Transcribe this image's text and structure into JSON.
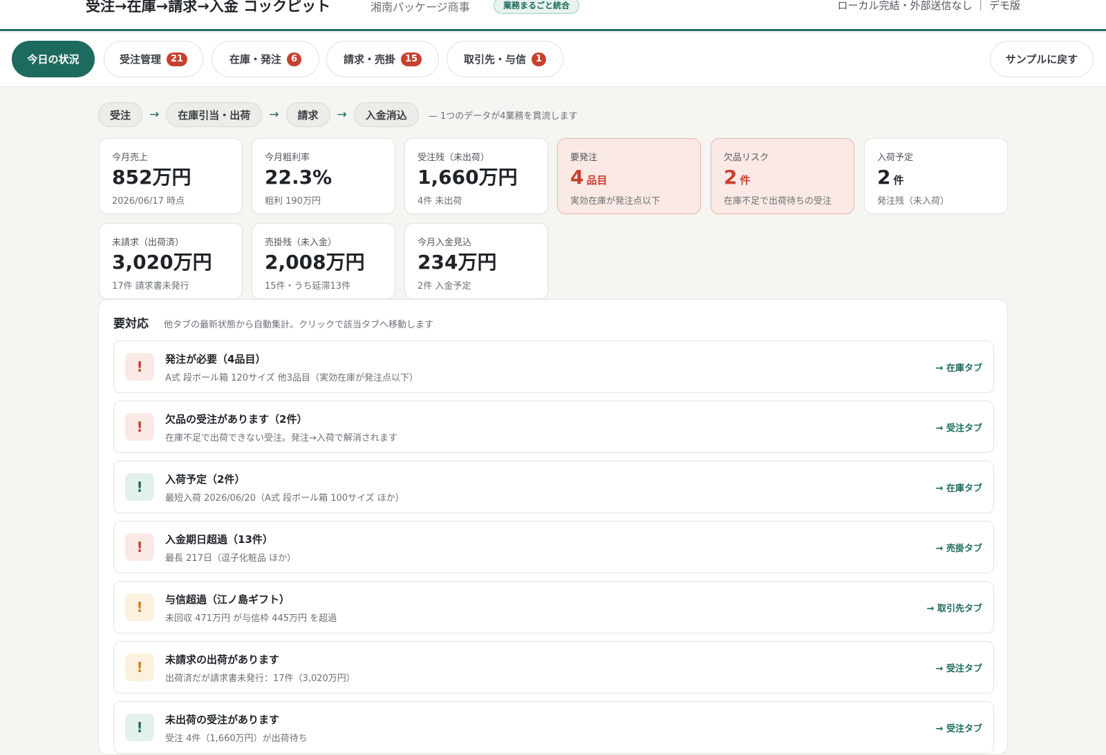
{
  "header": {
    "title": "受注→在庫→請求→入金 コックピット",
    "company": "湘南パッケージ商事",
    "badge": "業務まるごと統合",
    "right_info": "ローカル完結・外部送信なし ｜ デモ版"
  },
  "tabs": [
    {
      "label": "今日の状況",
      "count": null,
      "active": true
    },
    {
      "label": "受注管理",
      "count": "21"
    },
    {
      "label": "在庫・発注",
      "count": "6"
    },
    {
      "label": "請求・売掛",
      "count": "15"
    },
    {
      "label": "取引先・与信",
      "count": "1"
    }
  ],
  "reset_button": "サンプルに戻す",
  "flow": {
    "steps": [
      "受注",
      "在庫引当・出荷",
      "請求",
      "入金消込"
    ],
    "arrow": "→",
    "note": "— 1つのデータが4業務を貫流します"
  },
  "kpis": [
    {
      "label": "今月売上",
      "value": "852万円",
      "unit": "",
      "sub": "2026/06/17 時点",
      "alert": false
    },
    {
      "label": "今月粗利率",
      "value": "22.3%",
      "unit": "",
      "sub": "粗利 190万円",
      "alert": false
    },
    {
      "label": "受注残（未出荷）",
      "value": "1,660万円",
      "unit": "",
      "sub": "4件 未出荷",
      "alert": false
    },
    {
      "label": "要発注",
      "value": "4",
      "unit": "品目",
      "sub": "実効在庫が発注点以下",
      "alert": true
    },
    {
      "label": "欠品リスク",
      "value": "2",
      "unit": "件",
      "sub": "在庫不足で出荷待ちの受注",
      "alert": true
    },
    {
      "label": "入荷予定",
      "value": "2",
      "unit": "件",
      "sub": "発注残（未入荷）",
      "alert": false
    },
    {
      "label": "未請求（出荷済）",
      "value": "3,020万円",
      "unit": "",
      "sub": "17件 請求書未発行",
      "alert": false
    },
    {
      "label": "売掛残（未入金）",
      "value": "2,008万円",
      "unit": "",
      "sub": "15件・うち延滞13件",
      "alert": false
    },
    {
      "label": "今月入金見込",
      "value": "234万円",
      "unit": "",
      "sub": "2件 入金予定",
      "alert": false
    }
  ],
  "panel": {
    "title": "要対応",
    "desc": "他タブの最新状態から自動集計。クリックで該当タブへ移動します",
    "tasks": [
      {
        "icon": "!",
        "level": "red",
        "title": "発注が必要（4品目）",
        "desc": "A式 段ボール箱 120サイズ 他3品目（実効在庫が発注点以下）",
        "link": "→ 在庫タブ"
      },
      {
        "icon": "!",
        "level": "red",
        "title": "欠品の受注があります（2件）",
        "desc": "在庫不足で出荷できない受注。発注→入荷で解消されます",
        "link": "→ 受注タブ"
      },
      {
        "icon": "!",
        "level": "teal",
        "title": "入荷予定（2件）",
        "desc": "最短入荷 2026/06/20（A式 段ボール箱 100サイズ ほか）",
        "link": "→ 在庫タブ"
      },
      {
        "icon": "!",
        "level": "red",
        "title": "入金期日超過（13件）",
        "desc": "最長 217日（逗子化粧品 ほか）",
        "link": "→ 売掛タブ"
      },
      {
        "icon": "!",
        "level": "orange",
        "title": "与信超過（江ノ島ギフト）",
        "desc": "未回収 471万円 が与信枠 445万円 を超過",
        "link": "→ 取引先タブ"
      },
      {
        "icon": "!",
        "level": "orange",
        "title": "未請求の出荷があります",
        "desc": "出荷済だが請求書未発行：17件（3,020万円）",
        "link": "→ 受注タブ"
      },
      {
        "icon": "!",
        "level": "teal",
        "title": "未出荷の受注があります",
        "desc": "受注 4件（1,660万円）が出荷待ち",
        "link": "→ 受注タブ"
      }
    ]
  }
}
